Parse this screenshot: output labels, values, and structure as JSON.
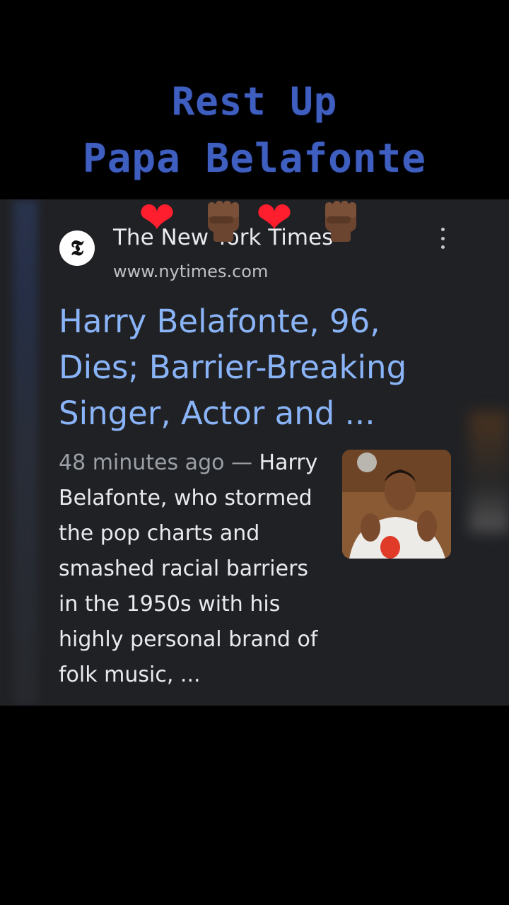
{
  "overlay": {
    "line1": "Rest Up",
    "line2": "Papa Belafonte",
    "emojis": [
      "heart",
      "raised-fist",
      "heart",
      "raised-fist"
    ],
    "title_color": "#3f5fc0"
  },
  "result": {
    "source_name": "The New York Times",
    "source_url": "www.nytimes.com",
    "favicon_letter": "𝕿",
    "headline": "Harry Belafonte, 96, Dies; Barrier-Breaking Singer, Actor and ...",
    "timestamp": "48 minutes ago —",
    "snippet": " Harry Belafonte, who stormed the pop charts and smashed racial barriers in the 1950s with his highly personal brand of folk music, ...",
    "link_color": "#8ab4f8",
    "card_bg": "#202124"
  }
}
